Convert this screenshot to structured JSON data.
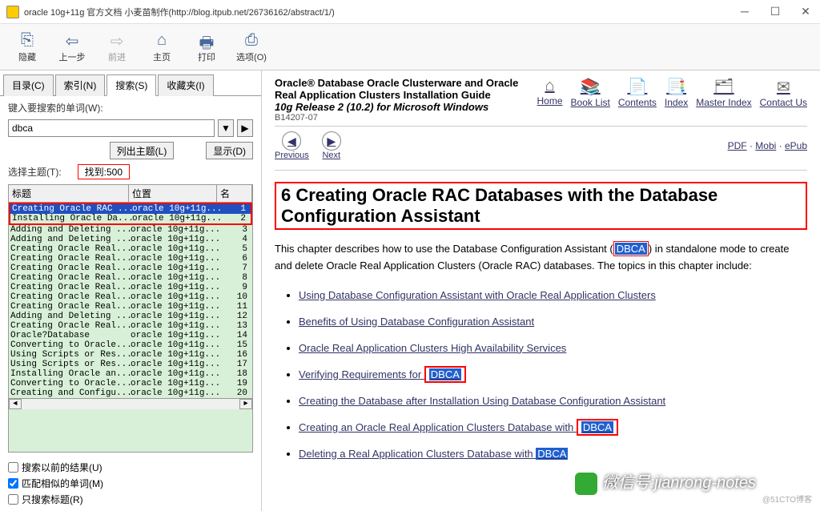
{
  "window": {
    "title": "oracle 10g+11g 官方文档 小麦苗制作(http://blog.itpub.net/26736162/abstract/1/)"
  },
  "toolbar": {
    "hide": "隐藏",
    "back": "上一步",
    "forward": "前进",
    "home": "主页",
    "print": "打印",
    "options": "选项(O)"
  },
  "tabs": {
    "contents": "目录(C)",
    "index": "索引(N)",
    "search": "搜索(S)",
    "favorites": "收藏夹(I)"
  },
  "search": {
    "label": "键入要搜索的单词(W):",
    "value": "dbca",
    "list_topics": "列出主题(L)",
    "display": "显示(D)",
    "select_label": "选择主题(T):",
    "found": "找到:500",
    "headers": {
      "title": "标题",
      "location": "位置",
      "rank": "名"
    },
    "results": [
      {
        "t": "Creating Oracle RAC ...",
        "l": "oracle 10g+11g...",
        "r": "1",
        "sel": true
      },
      {
        "t": "Installing Oracle Da...",
        "l": "oracle 10g+11g...",
        "r": "2"
      },
      {
        "t": "Adding and Deleting ...",
        "l": "oracle 10g+11g...",
        "r": "3"
      },
      {
        "t": "Adding and Deleting ...",
        "l": "oracle 10g+11g...",
        "r": "4"
      },
      {
        "t": "Creating Oracle Real...",
        "l": "oracle 10g+11g...",
        "r": "5"
      },
      {
        "t": "Creating Oracle Real...",
        "l": "oracle 10g+11g...",
        "r": "6"
      },
      {
        "t": "Creating Oracle Real...",
        "l": "oracle 10g+11g...",
        "r": "7"
      },
      {
        "t": "Creating Oracle Real...",
        "l": "oracle 10g+11g...",
        "r": "8"
      },
      {
        "t": "Creating Oracle Real...",
        "l": "oracle 10g+11g...",
        "r": "9"
      },
      {
        "t": "Creating Oracle Real...",
        "l": "oracle 10g+11g...",
        "r": "10"
      },
      {
        "t": "Creating Oracle Real...",
        "l": "oracle 10g+11g...",
        "r": "11"
      },
      {
        "t": "Adding and Deleting ...",
        "l": "oracle 10g+11g...",
        "r": "12"
      },
      {
        "t": "Creating Oracle Real...",
        "l": "oracle 10g+11g...",
        "r": "13"
      },
      {
        "t": "Oracle?Database     ",
        "l": "oracle 10g+11g...",
        "r": "14"
      },
      {
        "t": "Converting to Oracle...",
        "l": "oracle 10g+11g...",
        "r": "15"
      },
      {
        "t": "Using Scripts or Res...",
        "l": "oracle 10g+11g...",
        "r": "16"
      },
      {
        "t": "Using Scripts or Res...",
        "l": "oracle 10g+11g...",
        "r": "17"
      },
      {
        "t": "Installing Oracle an...",
        "l": "oracle 10g+11g...",
        "r": "18"
      },
      {
        "t": "Converting to Oracle...",
        "l": "oracle 10g+11g...",
        "r": "19"
      },
      {
        "t": "Creating and Configu...",
        "l": "oracle 10g+11g...",
        "r": "20"
      }
    ],
    "chk_previous": "搜索以前的结果(U)",
    "chk_similar": "匹配相似的单词(M)",
    "chk_titles": "只搜索标题(R)"
  },
  "doc": {
    "title1": "Oracle® Database Oracle Clusterware and Oracle Real Application Clusters Installation Guide",
    "title2": "10g Release 2 (10.2) for Microsoft Windows",
    "id": "B14207-07",
    "nav": {
      "home": "Home",
      "booklist": "Book List",
      "contents": "Contents",
      "index": "Index",
      "master": "Master Index",
      "contact": "Contact Us"
    },
    "prev": "Previous",
    "next": "Next",
    "formats": {
      "pdf": "PDF",
      "mobi": "Mobi",
      "epub": "ePub"
    },
    "chapter_title": "6 Creating Oracle RAC Databases with the Database Configuration Assistant",
    "para1a": "This chapter describes how to use the Database Configuration Assistant (",
    "para1_hl": "DBCA",
    "para1b": ") in standalone mode to create and delete Oracle Real Application Clusters (Oracle RAC) databases. The topics in this chapter include:",
    "links": [
      "Using Database Configuration Assistant with Oracle Real Application Clusters",
      "Benefits of Using Database Configuration Assistant",
      "Oracle Real Application Clusters High Availability Services"
    ],
    "link4a": "Verifying Requirements for ",
    "link4_hl": "DBCA",
    "link5": "Creating the Database after Installation Using Database Configuration Assistant",
    "link6a": "Creating an Oracle Real Application Clusters Database with ",
    "link6_hl": "DBCA",
    "link7a": "Deleting a Real Application Clusters Database with ",
    "link7_hl": "DBCA"
  },
  "watermark": "微信号:jianrong-notes",
  "watermark2": "@51CTO博客"
}
